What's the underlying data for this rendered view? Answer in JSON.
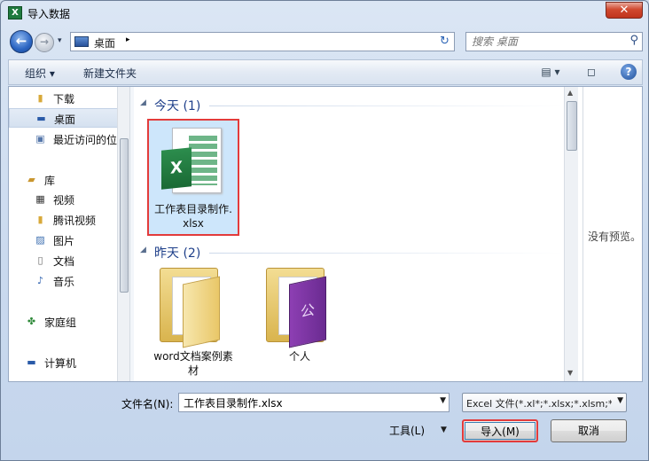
{
  "window": {
    "title": "导入数据",
    "app_icon": "X",
    "close_glyph": "✕"
  },
  "nav": {
    "back_glyph": "←",
    "forward_glyph": "→",
    "history_glyph": "▾",
    "refresh_glyph": "↻"
  },
  "address": {
    "location": "桌面",
    "separator": "▸"
  },
  "search": {
    "placeholder": "搜索 桌面"
  },
  "toolbar": {
    "organize": "组织 ▾",
    "new_folder": "新建文件夹",
    "view_glyph": "▤ ▾",
    "pane_glyph": "◻",
    "help_glyph": "?"
  },
  "sidebar": {
    "items": [
      {
        "label": "下载",
        "icon": "folder-icon"
      },
      {
        "label": "桌面",
        "icon": "desktop-icon"
      },
      {
        "label": "最近访问的位置",
        "icon": "recent-places-icon"
      },
      {
        "label": "库",
        "icon": "library-icon"
      },
      {
        "label": "视频",
        "icon": "video-icon"
      },
      {
        "label": "腾讯视频",
        "icon": "folder-icon"
      },
      {
        "label": "图片",
        "icon": "picture-icon"
      },
      {
        "label": "文档",
        "icon": "document-icon"
      },
      {
        "label": "音乐",
        "icon": "music-icon"
      },
      {
        "label": "家庭组",
        "icon": "homegroup-icon"
      },
      {
        "label": "计算机",
        "icon": "computer-icon"
      }
    ]
  },
  "groups": {
    "today": {
      "title": "今天 (1)"
    },
    "yesterday": {
      "title": "昨天 (2)"
    }
  },
  "files": {
    "excel": {
      "name_line1": "工作表目录制作.",
      "name_line2": "xlsx",
      "badge": "X"
    },
    "folder1": {
      "name_line1": "word文档案例素",
      "name_line2": "材"
    },
    "folder2": {
      "name_line1": "个人",
      "cover_text": "公"
    }
  },
  "preview": {
    "text": "没有预览。"
  },
  "bottom": {
    "filename_label": "文件名(N):",
    "filename_value": "工作表目录制作.xlsx",
    "filetype_value": "Excel 文件(*.xl*;*.xlsx;*.xlsm;*.",
    "tools_label": "工具(L)",
    "import_label": "导入(M)",
    "cancel_label": "取消"
  }
}
